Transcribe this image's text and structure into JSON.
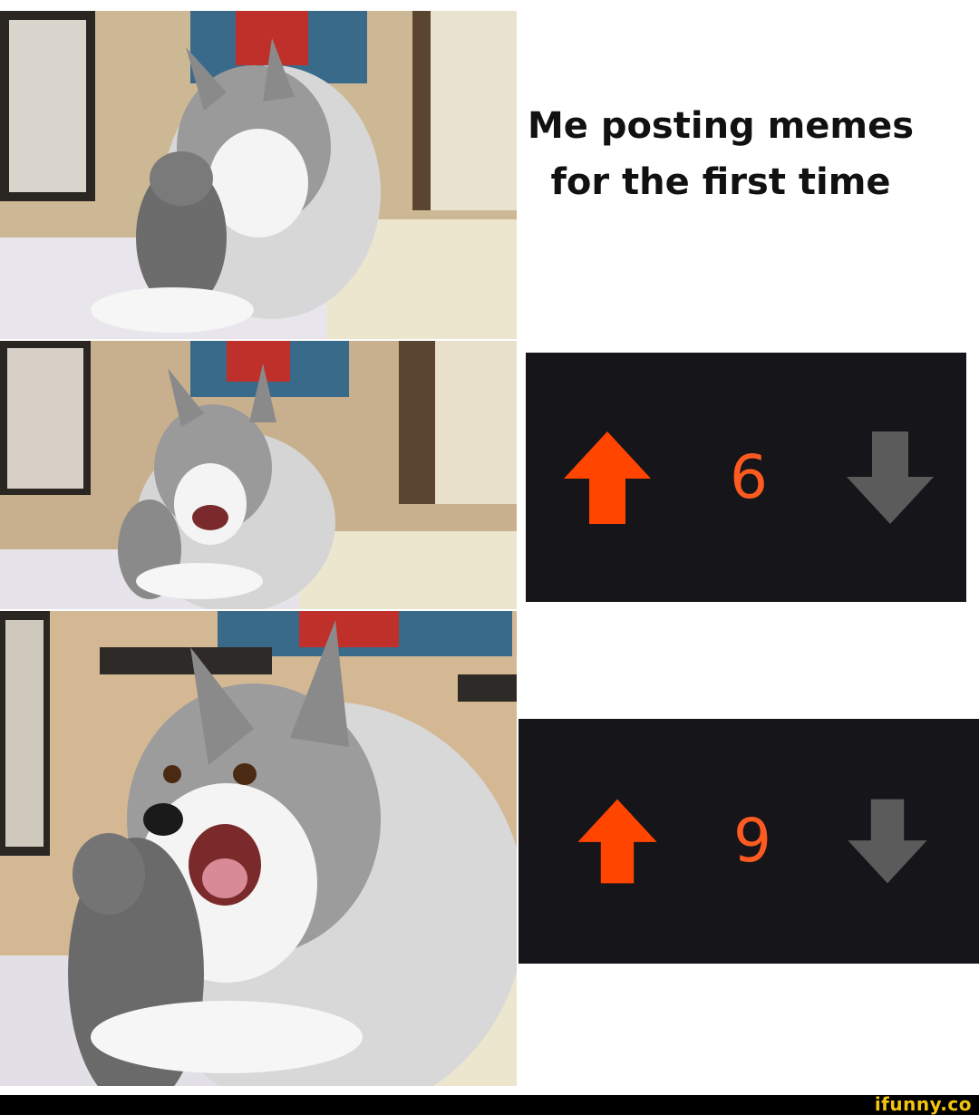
{
  "caption": {
    "line1": "Me posting memes",
    "line2": "for the first time"
  },
  "photos": [
    {
      "subject": "husky with plush toy, straight face"
    },
    {
      "subject": "husky with plush toy, grinning"
    },
    {
      "subject": "husky close-up, laughing"
    }
  ],
  "vote_panels": [
    {
      "count": "6",
      "upvote_icon": "arrow-up-icon",
      "downvote_icon": "arrow-down-icon"
    },
    {
      "count": "9",
      "upvote_icon": "arrow-up-icon",
      "downvote_icon": "arrow-down-icon"
    }
  ],
  "colors": {
    "upvote": "#ff4500",
    "count": "#ff5a1f",
    "downvote": "#5b5b5b",
    "vote_bg": "#16151a",
    "watermark": "#f3c50f"
  },
  "footer": {
    "watermark": "ifunny.co"
  }
}
